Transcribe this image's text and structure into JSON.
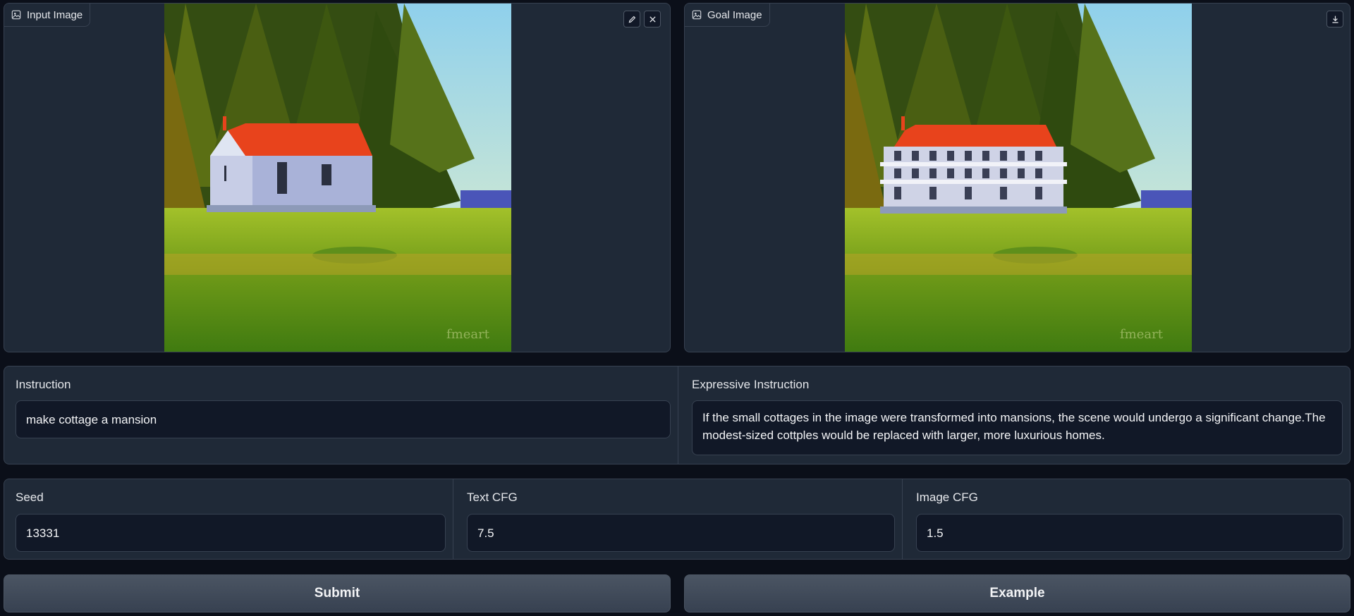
{
  "input_panel": {
    "label": "Input Image"
  },
  "goal_panel": {
    "label": "Goal Image"
  },
  "instruction": {
    "label": "Instruction",
    "value": "make cottage a mansion"
  },
  "expressive_instruction": {
    "label": "Expressive Instruction",
    "value": "If the small cottages in the image were transformed into mansions, the scene would undergo a significant change.The modest-sized cottples would be replaced with larger, more luxurious homes."
  },
  "seed": {
    "label": "Seed",
    "value": "13331"
  },
  "text_cfg": {
    "label": "Text CFG",
    "value": "7.5"
  },
  "image_cfg": {
    "label": "Image CFG",
    "value": "1.5"
  },
  "buttons": {
    "submit": "Submit",
    "example": "Example"
  },
  "colors": {
    "roof": "#e8431c",
    "grass": "#7fae1f",
    "sky": "#bfe3f0",
    "sea": "#4a55b8",
    "forest": "#2f4a12"
  }
}
